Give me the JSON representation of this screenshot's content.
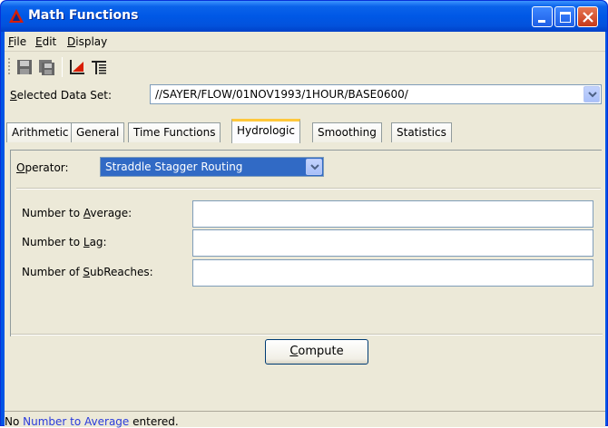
{
  "window": {
    "title": "Math Functions",
    "colors": {
      "titlebar": "#0058e6",
      "close_button": "#c6391a",
      "link_blue": "#2a3bdb",
      "tab_highlight": "#ffc83c"
    }
  },
  "menubar": {
    "items": [
      {
        "label": "File",
        "mnemonic": "F",
        "rest": "ile"
      },
      {
        "label": "Edit",
        "mnemonic": "E",
        "rest": "dit"
      },
      {
        "label": "Display",
        "mnemonic": "D",
        "rest": "isplay"
      }
    ]
  },
  "toolbar": {
    "icons": [
      "save-icon",
      "save-all-icon",
      "plot-icon",
      "tabulate-icon"
    ]
  },
  "dataset": {
    "label_mnemonic": "S",
    "label_rest": "elected Data Set:",
    "value": "//SAYER/FLOW/01NOV1993/1HOUR/BASE0600/"
  },
  "tabs": [
    {
      "label": "Arithmetic",
      "active": false
    },
    {
      "label": "General",
      "active": false
    },
    {
      "label": "Time Functions",
      "active": false
    },
    {
      "label": "Hydrologic",
      "active": true
    },
    {
      "label": "Smoothing",
      "active": false
    },
    {
      "label": "Statistics",
      "active": false
    }
  ],
  "operator": {
    "label_mnemonic": "O",
    "label_rest": "perator:",
    "value": "Straddle Stagger Routing"
  },
  "fields": [
    {
      "label_pre": "Number to ",
      "label_mnemonic": "A",
      "label_post": "verage:",
      "value": ""
    },
    {
      "label_pre": "Number to ",
      "label_mnemonic": "L",
      "label_post": "ag:",
      "value": ""
    },
    {
      "label_pre": "Number of ",
      "label_mnemonic": "S",
      "label_post": "ubReaches:",
      "value": ""
    }
  ],
  "compute": {
    "mnemonic": "C",
    "rest": "ompute"
  },
  "status": {
    "pre": "No ",
    "link": "Number to Average",
    "post": " entered."
  }
}
